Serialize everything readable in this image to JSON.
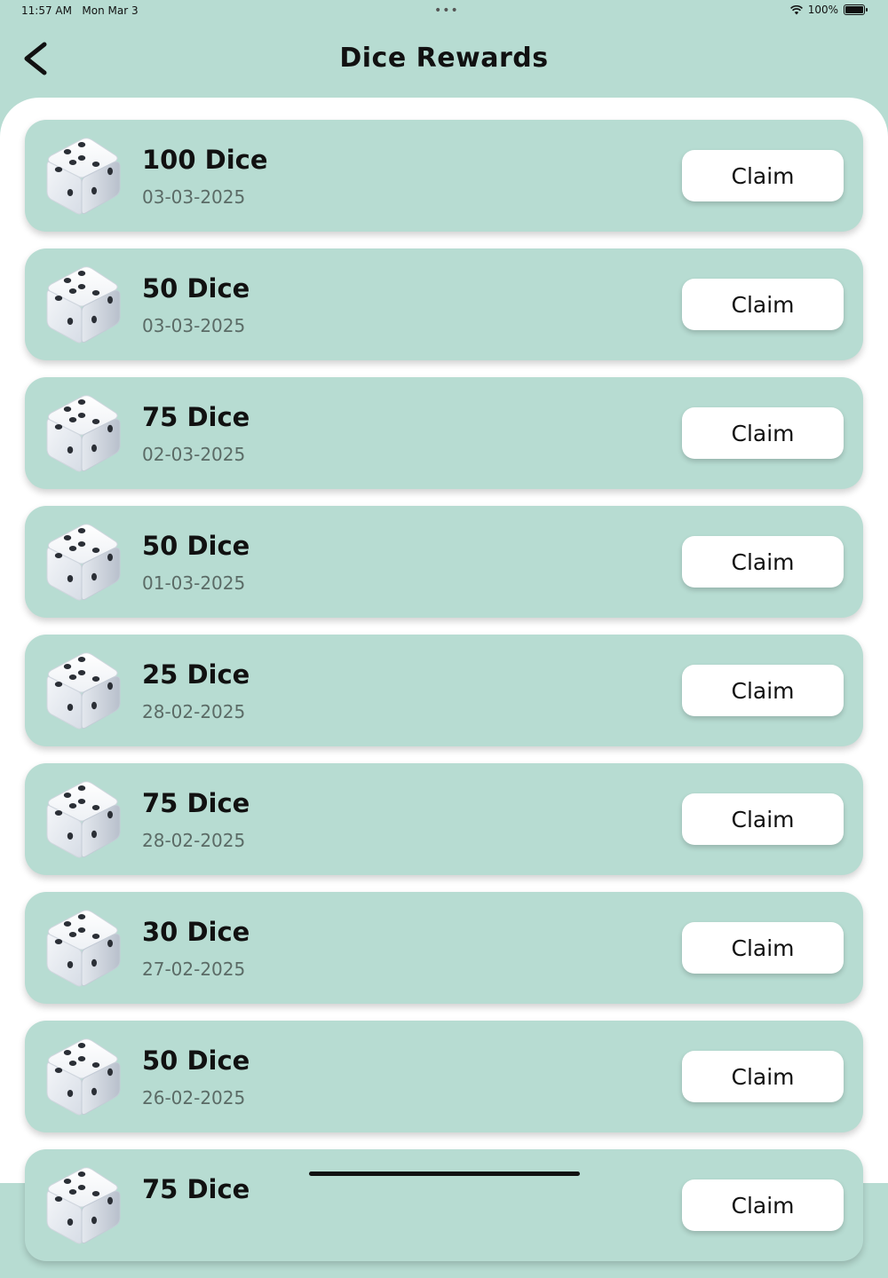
{
  "status": {
    "time": "11:57 AM",
    "date": "Mon Mar 3",
    "battery": "100%",
    "icons": [
      "wifi-icon",
      "battery-icon"
    ]
  },
  "header": {
    "title": "Dice Rewards",
    "back_icon": "chevron-left-icon"
  },
  "rewards": [
    {
      "amount": "100 Dice",
      "date": "03-03-2025",
      "button": "Claim"
    },
    {
      "amount": "50 Dice",
      "date": "03-03-2025",
      "button": "Claim"
    },
    {
      "amount": "75 Dice",
      "date": "02-03-2025",
      "button": "Claim"
    },
    {
      "amount": "50 Dice",
      "date": "01-03-2025",
      "button": "Claim"
    },
    {
      "amount": "25 Dice",
      "date": "28-02-2025",
      "button": "Claim"
    },
    {
      "amount": "75 Dice",
      "date": "28-02-2025",
      "button": "Claim"
    },
    {
      "amount": "30 Dice",
      "date": "27-02-2025",
      "button": "Claim"
    },
    {
      "amount": "50 Dice",
      "date": "26-02-2025",
      "button": "Claim"
    },
    {
      "amount": "75 Dice",
      "date": "",
      "button": "Claim"
    }
  ],
  "colors": {
    "background": "#b7dcd2",
    "card": "#b7dcd2",
    "sheet": "#ffffff",
    "button": "#ffffff"
  }
}
